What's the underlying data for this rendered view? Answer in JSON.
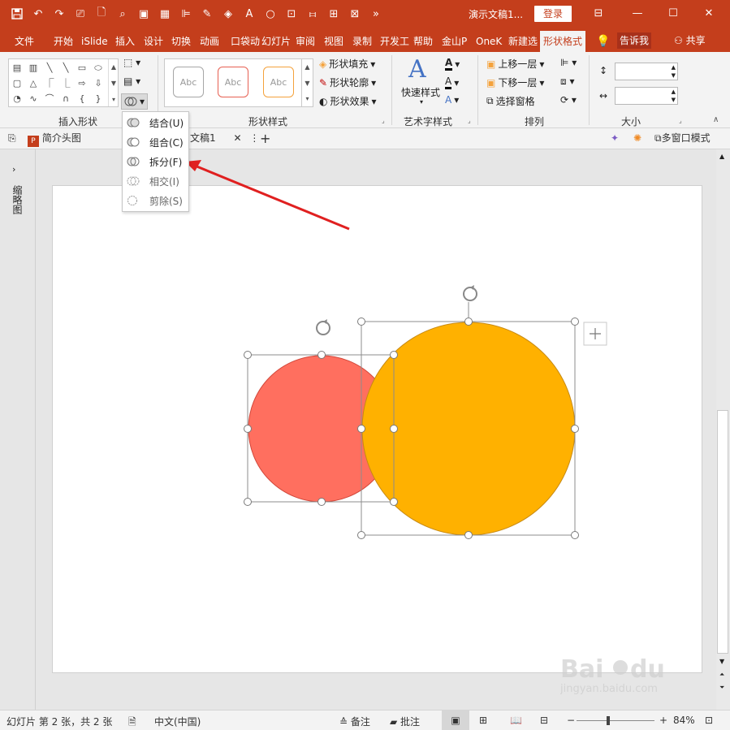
{
  "title_bar": {
    "doc_title": "演示文稿1...",
    "login_label": "登录",
    "qat_icons": [
      "save-icon",
      "undo-icon",
      "redo-icon",
      "from-beginning-icon",
      "new-icon",
      "print-preview-icon",
      "screenshot-icon",
      "grid-icon",
      "align-icon",
      "eyedropper-icon",
      "fill-color-icon",
      "font-color-icon",
      "circle-icon",
      "crop-icon",
      "distribute-icon",
      "flip-icon",
      "more-icon",
      "overflow-icon"
    ]
  },
  "tabs": [
    "文件",
    "开始",
    "iSlide",
    "插入",
    "设计",
    "切换",
    "动画",
    "口袋动",
    "幻灯片",
    "审阅",
    "视图",
    "录制",
    "开发工",
    "帮助",
    "金山P",
    "OneK",
    "新建选",
    "形状格式"
  ],
  "tellme": "告诉我",
  "share": "共享",
  "ribbon": {
    "groups": {
      "insert_shapes": "插入形状",
      "shape_styles": "形状样式",
      "wordart_styles": "艺术字样式",
      "arrange": "排列",
      "size": "大小"
    },
    "style_thumbs": [
      {
        "label": "Abc",
        "color": "#a6a6a6"
      },
      {
        "label": "Abc",
        "color": "#e76052"
      },
      {
        "label": "Abc",
        "color": "#f4a23c"
      }
    ],
    "shape_fill": "形状填充",
    "shape_outline": "形状轮廓",
    "shape_effect": "形状效果",
    "quick_styles": "快速样式",
    "bring_forward": "上移一层",
    "send_backward": "下移一层",
    "selection_pane": "选择窗格"
  },
  "merge_menu": {
    "items": [
      {
        "label": "结合(U)",
        "enabled": true
      },
      {
        "label": "组合(C)",
        "enabled": true
      },
      {
        "label": "拆分(F)",
        "enabled": true
      },
      {
        "label": "相交(I)",
        "enabled": true
      },
      {
        "label": "剪除(S)",
        "enabled": true
      }
    ]
  },
  "docbar": {
    "tab1": "简介头图",
    "tab2": "文稿1",
    "multi_window": "多窗口模式"
  },
  "left_pane": {
    "label": "缩略图"
  },
  "status": {
    "slide_info": "幻灯片 第 2 张，共 2 张",
    "language": "中文(中国)",
    "notes": "备注",
    "comments": "批注",
    "zoom": "84%"
  },
  "colors": {
    "accent": "#c43e1c",
    "red_circle": "#ff6f5f",
    "orange_circle": "#ffb100",
    "arrow": "#e02020"
  }
}
